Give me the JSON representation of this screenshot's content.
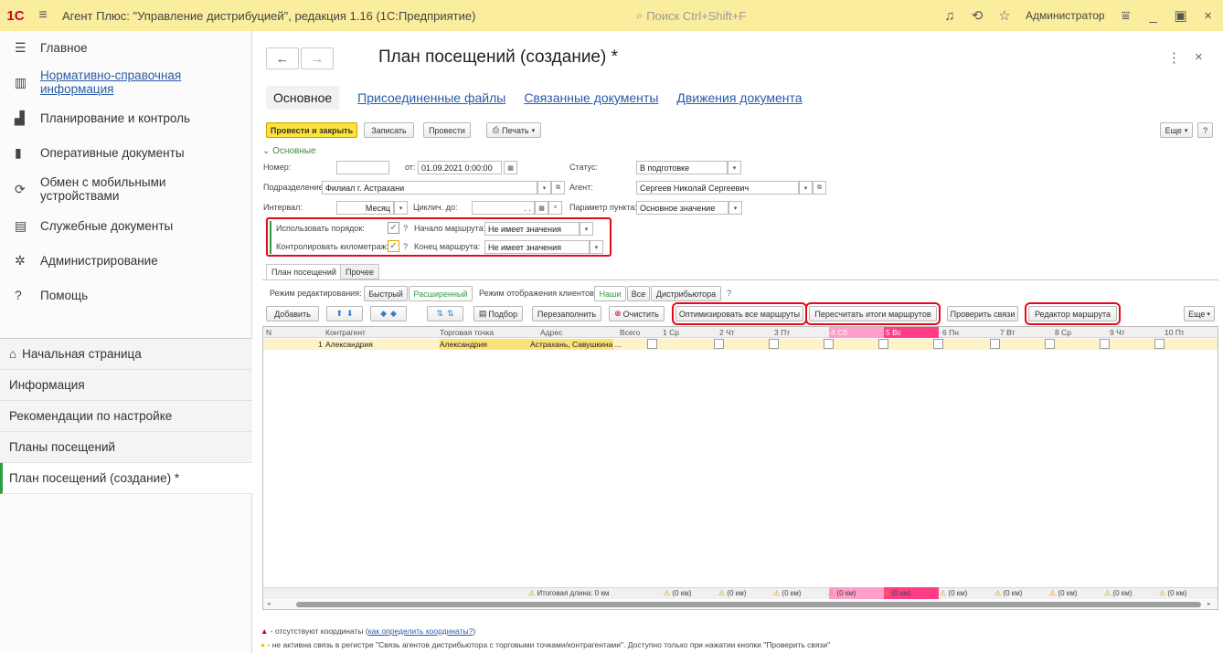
{
  "titlebar": {
    "logo": "1С",
    "title": "Агент Плюс: \"Управление дистрибуцией\", редакция 1.16 (1С:Предприятие)",
    "search_placeholder": "Поиск Ctrl+Shift+F",
    "user": "Администратор"
  },
  "sidebar": {
    "sections": [
      {
        "icon": "menu-icon",
        "label": "Главное"
      },
      {
        "icon": "catalog-icon",
        "label": "Нормативно-справочная информация"
      },
      {
        "icon": "chart-icon",
        "label": "Планирование и контроль"
      },
      {
        "icon": "docs-icon",
        "label": "Оперативные документы"
      },
      {
        "icon": "sync-icon",
        "label": "Обмен с мобильными устройствами"
      },
      {
        "icon": "service-docs-icon",
        "label": "Служебные документы"
      },
      {
        "icon": "gear-icon",
        "label": "Администрирование"
      },
      {
        "icon": "help-icon",
        "label": "Помощь"
      }
    ],
    "nav": [
      {
        "label": "Начальная страница"
      },
      {
        "label": "Информация"
      },
      {
        "label": "Рекомендации по настройке"
      },
      {
        "label": "Планы посещений"
      },
      {
        "label": "План посещений (создание) *"
      }
    ]
  },
  "doc": {
    "title": "План посещений (создание) *",
    "tabs": [
      "Основное",
      "Присоединенные файлы",
      "Связанные документы",
      "Движения документа"
    ]
  },
  "toolbar": {
    "post_close": "Провести и закрыть",
    "save": "Записать",
    "post": "Провести",
    "print": "Печать",
    "more": "Еще",
    "help": "?"
  },
  "form": {
    "group": "Основные",
    "number_label": "Номер:",
    "number_value": "",
    "date_label": "от:",
    "date_value": "01.09.2021 0:00:00",
    "status_label": "Статус:",
    "status_value": "В подготовке",
    "division_label": "Подразделение:",
    "division_value": "Филиал г. Астрахани",
    "agent_label": "Агент:",
    "agent_value": "Сергеев Николай Сергеевич",
    "interval_label": "Интервал:",
    "interval_value": "Месяц",
    "cyclic_label": "Циклич. до:",
    "cyclic_value": ". .",
    "point_param_label": "Параметр пункта:",
    "point_param_value": "Основное значение",
    "use_order_label": "Использовать порядок:",
    "route_start_label": "Начало маршрута:",
    "route_start_value": "Не имеет значения",
    "control_km_label": "Контролировать километраж:",
    "route_end_label": "Конец маршрута:",
    "route_end_value": "Не имеет значения",
    "q": "?"
  },
  "subtabs": [
    "План посещений",
    "Прочее"
  ],
  "modes": {
    "edit_label": "Режим редактирования:",
    "edit_fast": "Быстрый",
    "edit_ext": "Расширенный",
    "clients_label": "Режим отображения клиентов:",
    "clients_our": "Наши",
    "clients_all": "Все",
    "clients_dist": "Дистрибьютора",
    "q": "?"
  },
  "grid_toolbar": {
    "add": "Добавить",
    "pick": "Подбор",
    "refill": "Перезаполнить",
    "clear": "Очистить",
    "optimize": "Оптимизировать все маршруты",
    "recalc": "Пересчитать итоги маршрутов",
    "check": "Проверить связи",
    "editor": "Редактор маршрута",
    "more": "Еще"
  },
  "grid": {
    "headers": [
      "N",
      "Контрагент",
      "Торговая точка",
      "Адрес",
      "Всего",
      "1 Ср",
      "2 Чт",
      "3 Пт",
      "4 Сб",
      "5 Вс",
      "6 Пн",
      "7 Вт",
      "8 Ср",
      "9 Чт",
      "10 Пт"
    ],
    "row": {
      "n": "1",
      "counterparty": "Александрия",
      "point": "Александрия",
      "address": "Астрахань, Савушкина ..."
    },
    "footer_total": "Итоговая длина: 0 км",
    "footer_cell": "(0 км)"
  },
  "notes": {
    "n1_text": "- отсутствуют координаты (",
    "n1_link": "как определить координаты?",
    "n1_end": ")",
    "n2_text": "- не активна связь в регистре \"Связь агентов дистрибьютора с торговыми точками/контрагентами\". Доступно только при нажатии кнопки \"Проверить связи\""
  },
  "colors": {
    "accent_yellow": "#fce23b",
    "highlight_red": "#e30a1d",
    "weekend_pink": "#ff9ec8",
    "weekend_red": "#ff3d86",
    "active_green": "#2c9e3f"
  }
}
